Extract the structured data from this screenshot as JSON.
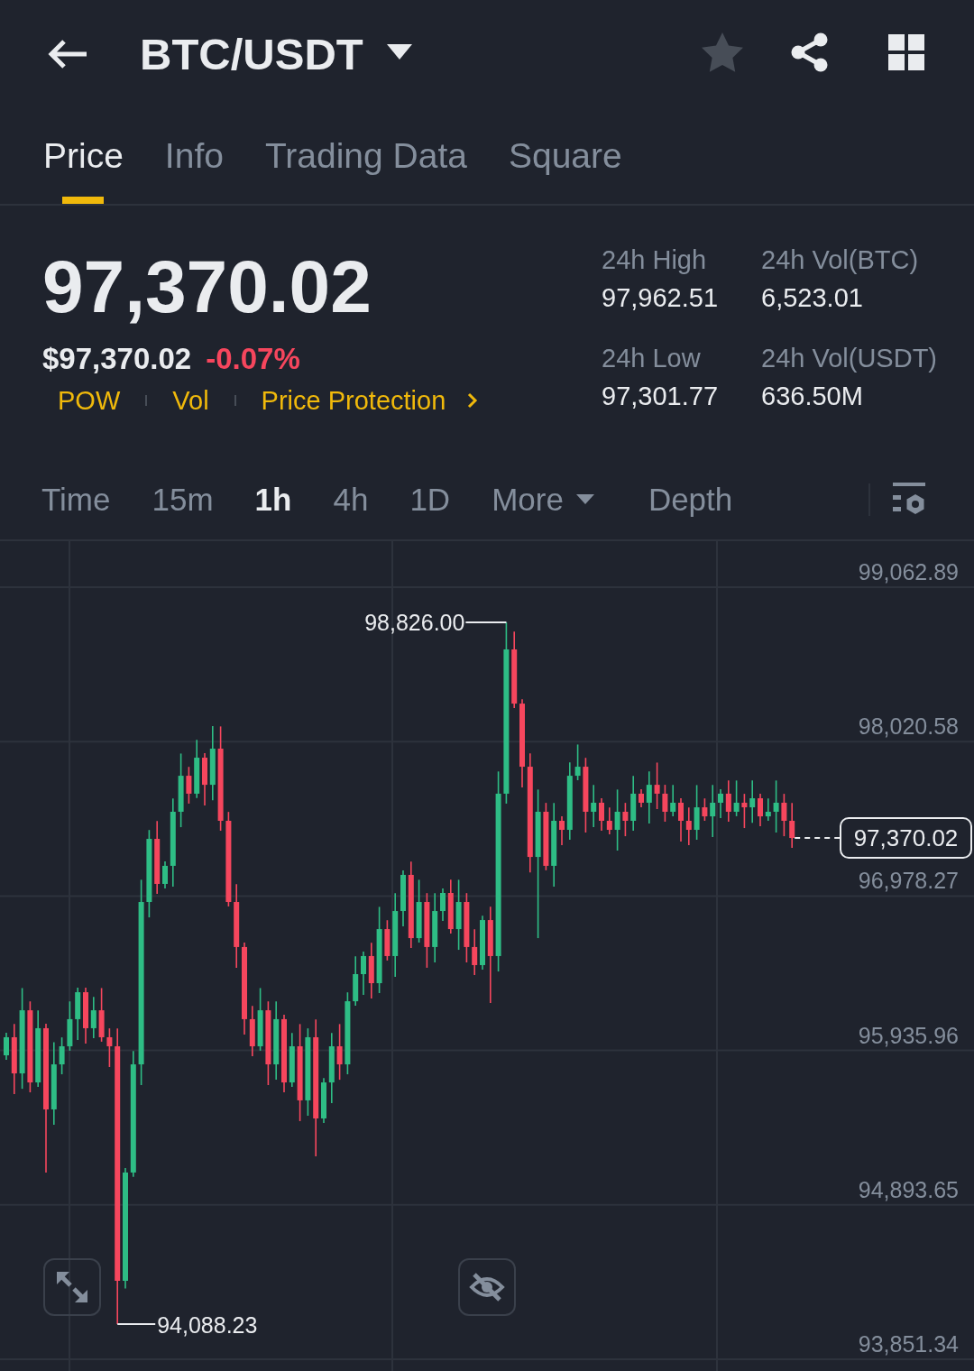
{
  "header": {
    "title": "BTC/USDT",
    "favorited": false
  },
  "tabs": [
    {
      "label": "Price",
      "selected": true
    },
    {
      "label": "Info",
      "selected": false
    },
    {
      "label": "Trading Data",
      "selected": false
    },
    {
      "label": "Square",
      "selected": false
    }
  ],
  "ticker": {
    "last_price": "97,370.02",
    "usd_price": "$97,370.02",
    "change": "-0.07%",
    "change_down": true,
    "tags": [
      "POW",
      "Vol"
    ],
    "link": "Price Protection"
  },
  "stats": [
    {
      "label": "24h High",
      "value": "97,962.51"
    },
    {
      "label": "24h Vol(BTC)",
      "value": "6,523.01"
    },
    {
      "label": "24h Low",
      "value": "97,301.77"
    },
    {
      "label": "24h Vol(USDT)",
      "value": "636.50M"
    }
  ],
  "intervals": [
    {
      "label": "Time",
      "kind": "interval",
      "selected": false
    },
    {
      "label": "15m",
      "kind": "interval",
      "selected": false
    },
    {
      "label": "1h",
      "kind": "interval",
      "selected": true
    },
    {
      "label": "4h",
      "kind": "interval",
      "selected": false
    },
    {
      "label": "1D",
      "kind": "interval",
      "selected": false
    },
    {
      "label": "More",
      "kind": "dropdown",
      "selected": false
    },
    {
      "label": "Depth",
      "kind": "view",
      "selected": false
    }
  ],
  "chart": {
    "chart_data": {
      "type": "candlestick",
      "grid": true,
      "ylim": [
        93772.19,
        99373.39
      ],
      "yticks": [
        {
          "value": 99062.89,
          "label": "99,062.89"
        },
        {
          "value": 98020.58,
          "label": "98,020.58"
        },
        {
          "value": 96978.27,
          "label": "96,978.27"
        },
        {
          "value": 95935.96,
          "label": "95,935.96"
        },
        {
          "value": 94893.65,
          "label": "94,893.65"
        },
        {
          "value": 93851.34,
          "label": "93,851.34"
        }
      ],
      "annotations": [
        "98,826.00",
        "94,088.23",
        "97,370.02"
      ],
      "ohlc": [
        [
          95903,
          96055,
          95873,
          96025
        ],
        [
          96025,
          96115,
          95641,
          95781
        ],
        [
          95781,
          96357,
          95677,
          96207
        ],
        [
          96207,
          96267,
          95653,
          95720
        ],
        [
          95720,
          96206,
          95690,
          96086
        ],
        [
          96086,
          96116,
          95112,
          95538
        ],
        [
          95538,
          95992,
          95434,
          95842
        ],
        [
          95842,
          96024,
          95775,
          95964
        ],
        [
          95964,
          96267,
          95934,
          96147
        ],
        [
          96147,
          96359,
          96007,
          96329
        ],
        [
          96329,
          96359,
          95982,
          96086
        ],
        [
          96086,
          96297,
          96019,
          96207
        ],
        [
          96207,
          96357,
          95995,
          96025
        ],
        [
          96025,
          96085,
          95824,
          95964
        ],
        [
          95964,
          96084,
          94088.23,
          94381
        ],
        [
          94381,
          95142,
          94330,
          95112
        ],
        [
          95112,
          95932,
          95082,
          95842
        ],
        [
          95842,
          97088,
          95702,
          96938
        ],
        [
          96938,
          97424,
          96834,
          97364
        ],
        [
          97364,
          97484,
          96993,
          97060
        ],
        [
          97060,
          97212,
          97030,
          97182
        ],
        [
          97182,
          97637,
          97042,
          97547
        ],
        [
          97547,
          97940,
          97443,
          97790
        ],
        [
          97790,
          97850,
          97602,
          97669
        ],
        [
          97669,
          98032,
          97639,
          97912
        ],
        [
          97912,
          97942,
          97589,
          97729
        ],
        [
          97729,
          98125,
          97625,
          97973
        ],
        [
          97973,
          98123,
          97419,
          97486
        ],
        [
          97486,
          97546,
          96908,
          96938
        ],
        [
          96938,
          97058,
          96494,
          96634
        ],
        [
          96634,
          96664,
          96043,
          96147
        ],
        [
          96147,
          96237,
          95897,
          95964
        ],
        [
          95964,
          96357,
          95934,
          96207
        ],
        [
          96207,
          96267,
          95702,
          95842
        ],
        [
          95842,
          96267,
          95738,
          96147
        ],
        [
          96147,
          96177,
          95653,
          95720
        ],
        [
          95720,
          96054,
          95690,
          95964
        ],
        [
          95964,
          96114,
          95459,
          95599
        ],
        [
          95599,
          96085,
          95495,
          96025
        ],
        [
          96025,
          96145,
          95221,
          95477
        ],
        [
          95477,
          95750,
          95447,
          95720
        ],
        [
          95720,
          96054,
          95580,
          95964
        ],
        [
          95964,
          96114,
          95738,
          95842
        ],
        [
          95842,
          96328,
          95775,
          96268
        ],
        [
          96268,
          96571,
          96238,
          96451
        ],
        [
          96451,
          96603,
          96311,
          96573
        ],
        [
          96573,
          96663,
          96286,
          96390
        ],
        [
          96390,
          96905,
          96323,
          96755
        ],
        [
          96755,
          96815,
          96543,
          96573
        ],
        [
          96573,
          96997,
          96433,
          96877
        ],
        [
          96877,
          97151,
          96773,
          97121
        ],
        [
          97121,
          97211,
          96627,
          96694
        ],
        [
          96694,
          97088,
          96664,
          96938
        ],
        [
          96938,
          96998,
          96494,
          96634
        ],
        [
          96634,
          96997,
          96530,
          96877
        ],
        [
          96877,
          97029,
          96810,
          96999
        ],
        [
          96999,
          97089,
          96725,
          96755
        ],
        [
          96755,
          97088,
          96615,
          96938
        ],
        [
          96938,
          96998,
          96530,
          96634
        ],
        [
          96634,
          96754,
          96445,
          96512
        ],
        [
          96512,
          96846,
          96482,
          96816
        ],
        [
          96816,
          96906,
          96256,
          96573
        ],
        [
          96573,
          97819,
          96469,
          97669
        ],
        [
          97669,
          98826.0,
          97602,
          98643
        ],
        [
          98643,
          98763,
          98247,
          98277
        ],
        [
          98277,
          98307,
          97711,
          97851
        ],
        [
          97851,
          97941,
          97138,
          97242
        ],
        [
          97242,
          97697,
          96694,
          97547
        ],
        [
          97547,
          97607,
          97152,
          97182
        ],
        [
          97182,
          97606,
          97042,
          97486
        ],
        [
          97486,
          97516,
          97321,
          97425
        ],
        [
          97425,
          97880,
          97358,
          97790
        ],
        [
          97790,
          98001,
          97760,
          97851
        ],
        [
          97851,
          97911,
          97407,
          97547
        ],
        [
          97547,
          97728,
          97443,
          97608
        ],
        [
          97608,
          97638,
          97419,
          97486
        ],
        [
          97486,
          97576,
          97395,
          97425
        ],
        [
          97425,
          97697,
          97285,
          97547
        ],
        [
          97547,
          97607,
          97382,
          97486
        ],
        [
          97486,
          97789,
          97419,
          97669
        ],
        [
          97669,
          97699,
          97578,
          97608
        ],
        [
          97608,
          97819,
          97468,
          97729
        ],
        [
          97729,
          97879,
          97565,
          97669
        ],
        [
          97669,
          97729,
          97480,
          97547
        ],
        [
          97547,
          97728,
          97517,
          97608
        ],
        [
          97608,
          97638,
          97346,
          97486
        ],
        [
          97486,
          97576,
          97321,
          97425
        ],
        [
          97425,
          97727,
          97358,
          97577
        ],
        [
          97577,
          97637,
          97486,
          97516
        ],
        [
          97516,
          97728,
          97376,
          97608
        ],
        [
          97608,
          97699,
          97504,
          97669
        ],
        [
          97669,
          97759,
          97480,
          97547
        ],
        [
          97547,
          97758,
          97517,
          97608
        ],
        [
          97608,
          97668,
          97437,
          97577
        ],
        [
          97577,
          97758,
          97473,
          97638
        ],
        [
          97638,
          97668,
          97449,
          97516
        ],
        [
          97516,
          97637,
          97486,
          97547
        ],
        [
          97547,
          97758,
          97407,
          97608
        ],
        [
          97608,
          97668,
          97382,
          97486
        ],
        [
          97486,
          97606,
          97303,
          97370.02
        ]
      ]
    }
  }
}
